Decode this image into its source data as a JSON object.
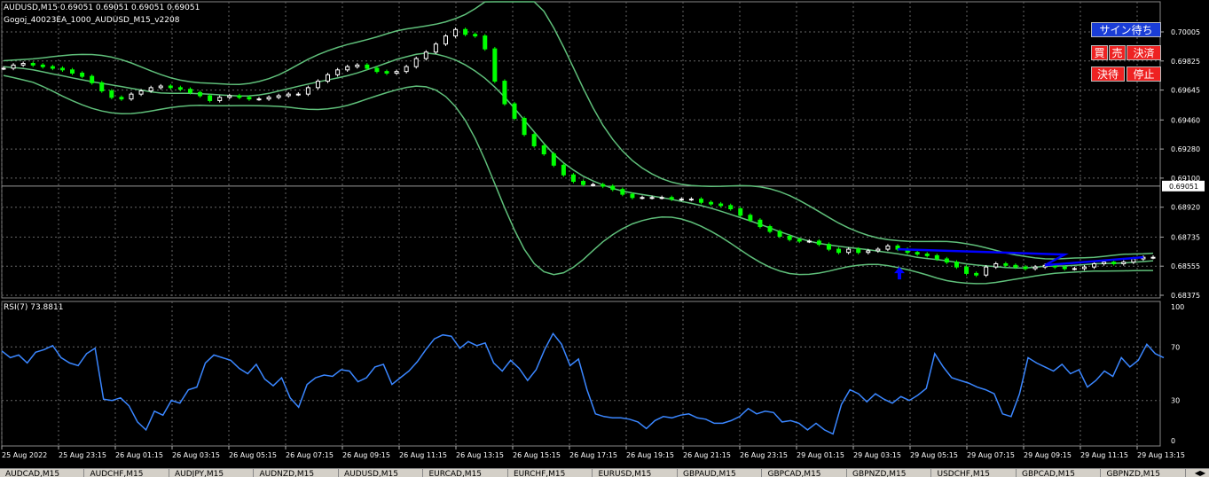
{
  "header": {
    "symbol_line": "AUDUSD,M15  0.69051 0.69051 0.69051 0.69051",
    "ea_line": "Gogoj_40023EA_1000_AUDUSD_M15_v2208"
  },
  "buttons": {
    "sign_wait": "サイン待ち",
    "buy": "買",
    "sell": "売",
    "settle": "決済",
    "settle_wait": "決待",
    "stop": "停止"
  },
  "price_axis": {
    "labels": [
      "0.70005",
      "0.69825",
      "0.69645",
      "0.69460",
      "0.69280",
      "0.69100",
      "0.68920",
      "0.68735",
      "0.68555",
      "0.68375"
    ],
    "current": "0.69051"
  },
  "rsi": {
    "label": "RSI(7) 73.8811",
    "levels": [
      "100",
      "70",
      "30",
      "0"
    ]
  },
  "time_axis": [
    "25 Aug 2022",
    "25 Aug 23:15",
    "26 Aug 01:15",
    "26 Aug 03:15",
    "26 Aug 05:15",
    "26 Aug 07:15",
    "26 Aug 09:15",
    "26 Aug 11:15",
    "26 Aug 13:15",
    "26 Aug 15:15",
    "26 Aug 17:15",
    "26 Aug 19:15",
    "26 Aug 21:15",
    "26 Aug 23:15",
    "29 Aug 01:15",
    "29 Aug 03:15",
    "29 Aug 05:15",
    "29 Aug 07:15",
    "29 Aug 09:15",
    "29 Aug 11:15",
    "29 Aug 13:15"
  ],
  "tabs": [
    "AUDCAD,M15",
    "AUDCHF,M15",
    "AUDJPY,M15",
    "AUDNZD,M15",
    "AUDUSD,M15",
    "EURCAD,M15",
    "EURCHF,M15",
    "EURUSD,M15",
    "GBPAUD,M15",
    "GBPCAD,M15",
    "GBPNZD,M15",
    "USDCHF,M15",
    "GBPCAD,M15",
    "GBPNZD,M15"
  ],
  "colors": {
    "bull_candle": "#ffffff",
    "bear_candle": "#00ff00",
    "bands": "#5fbf7a",
    "trendline": "#0000ff",
    "rsi_line": "#3a86ff",
    "grid": "#666666"
  },
  "chart_data": {
    "type": "line",
    "series": [
      {
        "values": [
          0.6978,
          0.698,
          0.6981,
          0.698,
          0.6979,
          0.6978,
          0.6977,
          0.6975,
          0.6973,
          0.6969,
          0.6964,
          0.696,
          0.6959,
          0.6962,
          0.6964,
          0.6966,
          0.6967,
          0.6966,
          0.6965,
          0.6963,
          0.6961,
          0.6958,
          0.696,
          0.6961,
          0.696,
          0.6959,
          0.6959,
          0.696,
          0.6961,
          0.6962,
          0.6962,
          0.6966,
          0.697,
          0.6974,
          0.6977,
          0.6979,
          0.698,
          0.6978,
          0.6976,
          0.6975,
          0.6976,
          0.6979,
          0.6984,
          0.6988,
          0.6993,
          0.6998,
          0.7002,
          0.6999,
          0.6998,
          0.699,
          0.697,
          0.6956,
          0.6947,
          0.6937,
          0.693,
          0.6925,
          0.6918,
          0.6912,
          0.6908,
          0.6906,
          0.6906,
          0.6905,
          0.6903,
          0.69,
          0.6898,
          0.6898,
          0.6898,
          0.6898,
          0.6897,
          0.6897,
          0.6897,
          0.6895,
          0.6894,
          0.6893,
          0.6891,
          0.6887,
          0.6884,
          0.688,
          0.6877,
          0.6874,
          0.6872,
          0.6871,
          0.6871,
          0.6869,
          0.6866,
          0.6864,
          0.6866,
          0.6864,
          0.6865,
          0.6866,
          0.6868,
          0.6866,
          0.6864,
          0.6863,
          0.6862,
          0.686,
          0.6858,
          0.6855,
          0.6851,
          0.685,
          0.6855,
          0.6857,
          0.6856,
          0.6855,
          0.6854,
          0.6855,
          0.6856,
          0.6855,
          0.6854,
          0.6854,
          0.6855,
          0.6857,
          0.6858,
          0.6857,
          0.6858,
          0.686,
          0.6861,
          0.6861
        ]
      },
      {
        "values": [
          67,
          62,
          64,
          58,
          66,
          68,
          71,
          62,
          58,
          56,
          65,
          69,
          31,
          30,
          32,
          26,
          14,
          8,
          22,
          19,
          30,
          28,
          38,
          40,
          58,
          64,
          62,
          60,
          54,
          50,
          57,
          46,
          41,
          47,
          32,
          25,
          42,
          47,
          49,
          48,
          53,
          52,
          44,
          47,
          55,
          57,
          42,
          47,
          52,
          59,
          68,
          76,
          79,
          78,
          69,
          74,
          71,
          73,
          58,
          52,
          60,
          54,
          45,
          53,
          68,
          80,
          72,
          56,
          61,
          38,
          20,
          18,
          17,
          17,
          16,
          14,
          9,
          15,
          18,
          17,
          19,
          20,
          17,
          16,
          13,
          13,
          15,
          18,
          24,
          20,
          22,
          21,
          14,
          15,
          13,
          8,
          13,
          8,
          5,
          27,
          38,
          35,
          29,
          35,
          31,
          28,
          33,
          30,
          34,
          39,
          65,
          55,
          47,
          45,
          43,
          40,
          38,
          35,
          20,
          18,
          35,
          62,
          58,
          55,
          52,
          57,
          50,
          53,
          40,
          45,
          52,
          48,
          62,
          55,
          60,
          72,
          65,
          62
        ]
      }
    ],
    "ylim": [
      0.68375,
      0.70005
    ],
    "rsi_ylim": [
      0,
      100
    ],
    "grid": true
  }
}
